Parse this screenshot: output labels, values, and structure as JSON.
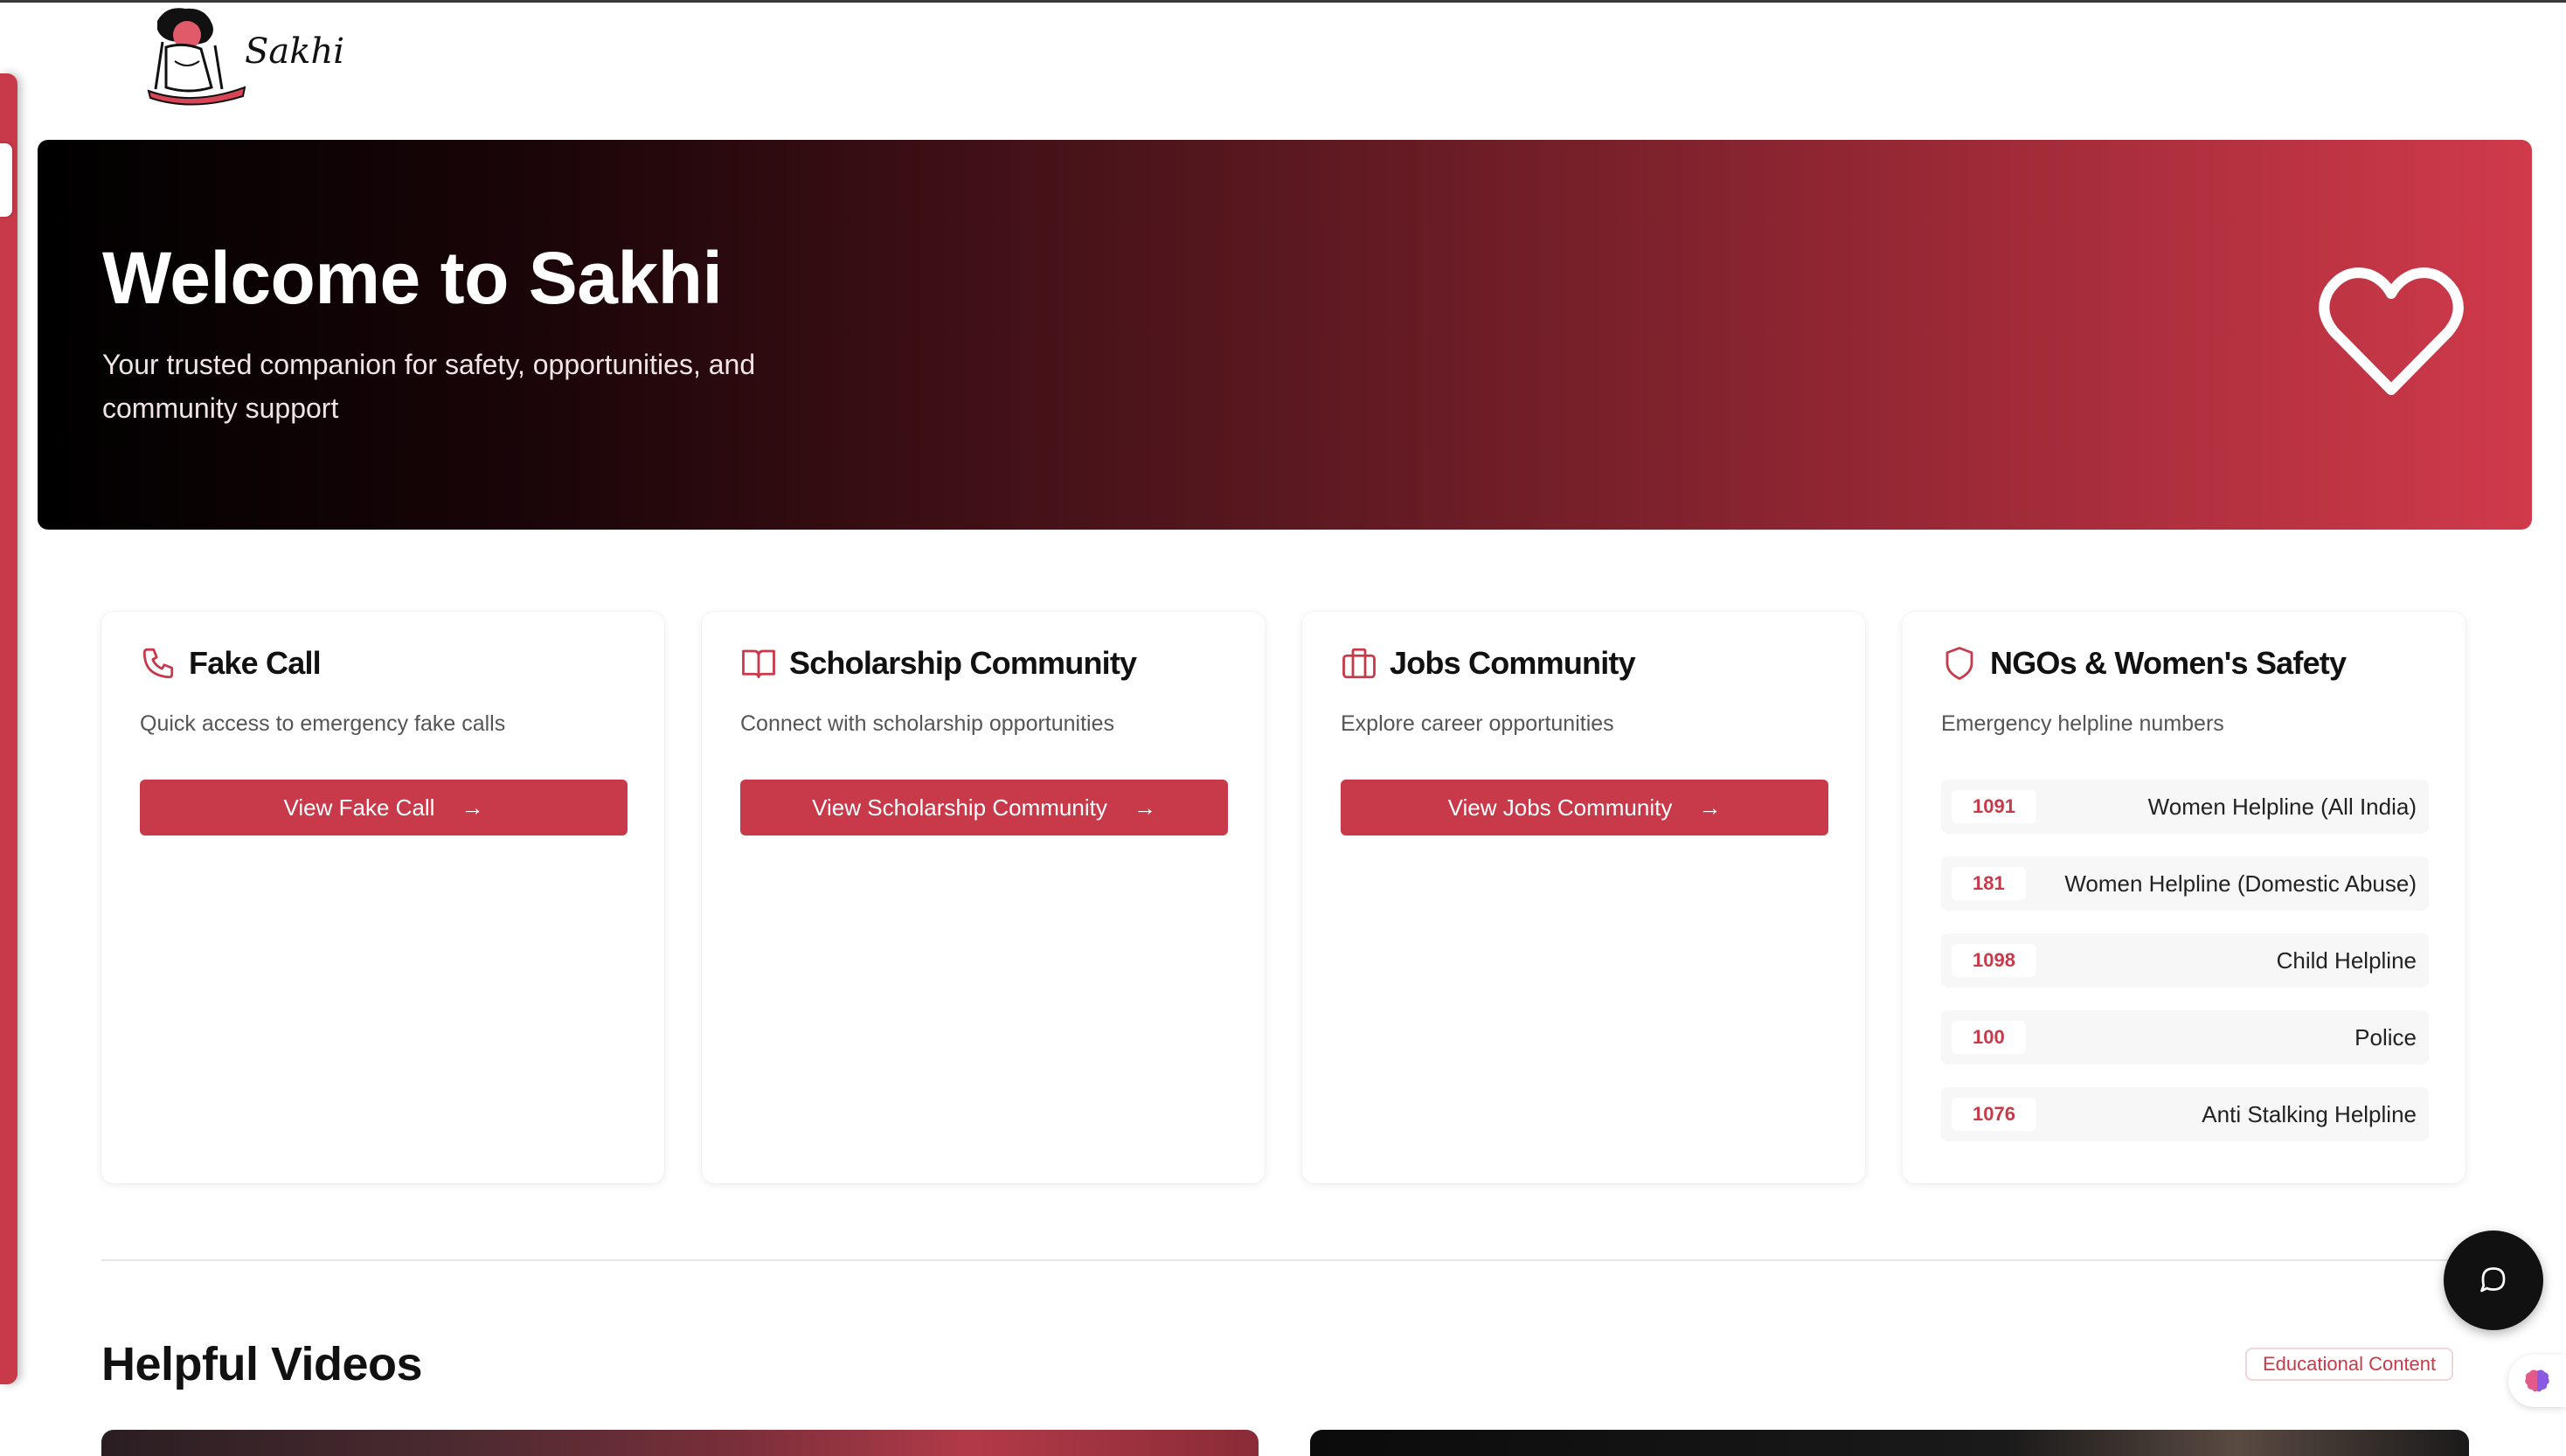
{
  "brand": {
    "name": "Sakhi"
  },
  "hero": {
    "title": "Welcome to Sakhi",
    "subtitle": "Your trusted companion for safety, opportunities, and community support"
  },
  "cards": [
    {
      "title": "Fake Call",
      "description": "Quick access to emergency fake calls",
      "button": "View Fake Call",
      "icon": "phone-icon"
    },
    {
      "title": "Scholarship Community",
      "description": "Connect with scholarship opportunities",
      "button": "View Scholarship Community",
      "icon": "book-icon"
    },
    {
      "title": "Jobs Community",
      "description": "Explore career opportunities",
      "button": "View Jobs Community",
      "icon": "briefcase-icon"
    },
    {
      "title": "NGOs & Women's Safety",
      "description": "Emergency helpline numbers",
      "icon": "shield-icon",
      "helplines": [
        {
          "number": "1091",
          "name": "Women Helpline (All India)"
        },
        {
          "number": "181",
          "name": "Women Helpline (Domestic Abuse)"
        },
        {
          "number": "1098",
          "name": "Child Helpline"
        },
        {
          "number": "100",
          "name": "Police"
        },
        {
          "number": "1076",
          "name": "Anti Stalking Helpline"
        }
      ]
    }
  ],
  "videos": {
    "title": "Helpful Videos",
    "badge": "Educational Content"
  },
  "colors": {
    "accent": "#c8394a",
    "dark": "#111111"
  }
}
